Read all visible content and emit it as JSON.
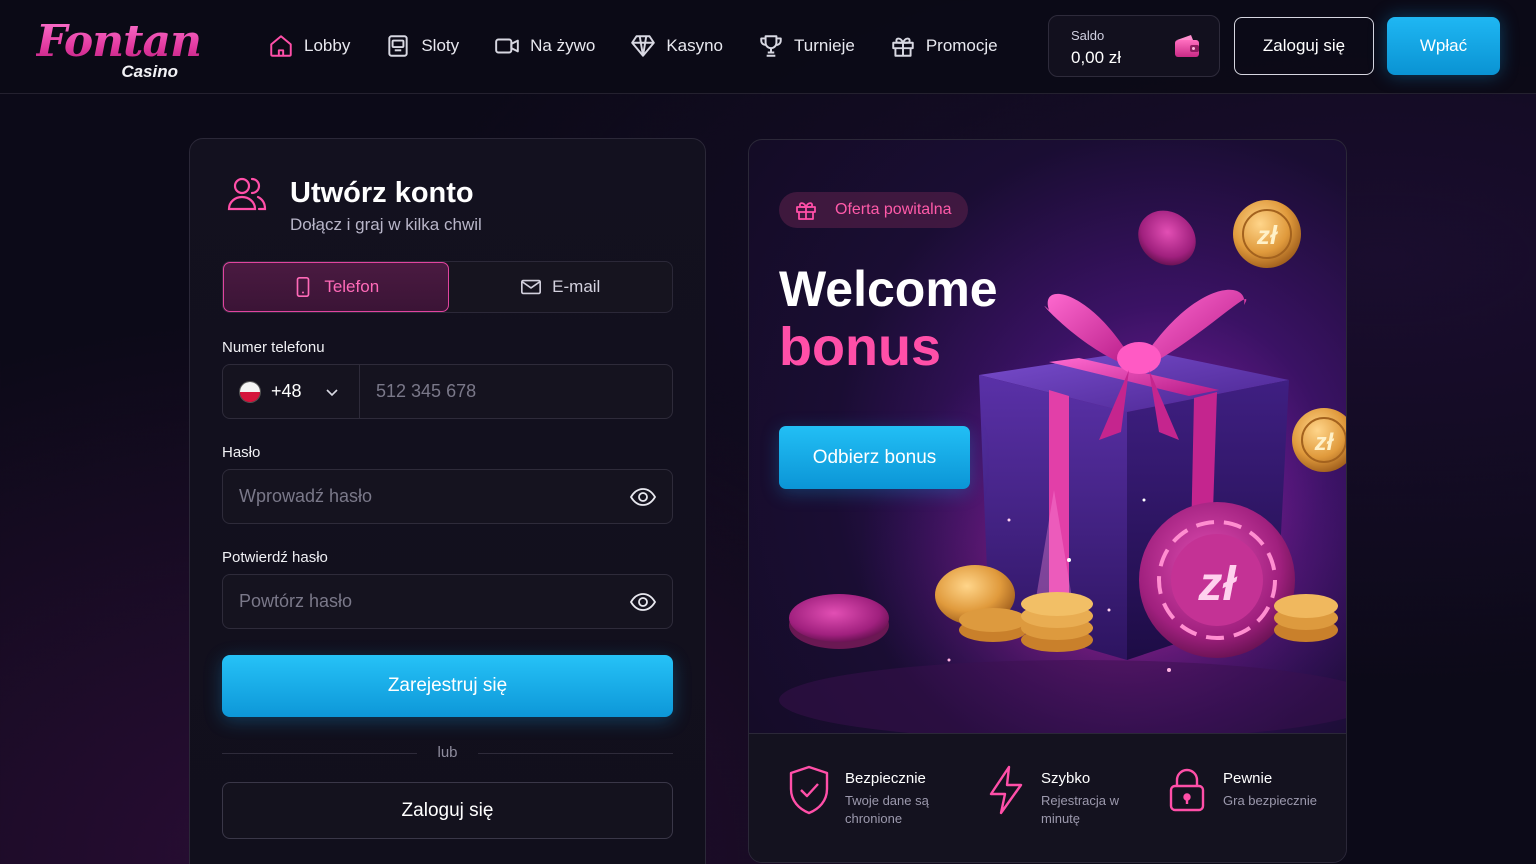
{
  "brand": {
    "name": "Fontan",
    "sub": "Casino"
  },
  "nav": [
    {
      "label": "Lobby",
      "icon": "home-icon"
    },
    {
      "label": "Sloty",
      "icon": "slot-machine-icon"
    },
    {
      "label": "Na żywo",
      "icon": "video-camera-icon"
    },
    {
      "label": "Kasyno",
      "icon": "diamond-icon"
    },
    {
      "label": "Turnieje",
      "icon": "trophy-icon"
    },
    {
      "label": "Promocje",
      "icon": "gift-icon"
    }
  ],
  "balance": {
    "label": "Saldo",
    "value": "0,00 zł"
  },
  "header_buttons": {
    "login": "Zaloguj się",
    "deposit": "Wpłać"
  },
  "register": {
    "title": "Utwórz konto",
    "subtitle": "Dołącz i graj w kilka chwil",
    "tabs": [
      {
        "label": "Telefon",
        "active": true
      },
      {
        "label": "E-mail",
        "active": false
      }
    ],
    "phone_label": "Numer telefonu",
    "country_code": "+48",
    "phone_placeholder": "512 345 678",
    "password_label": "Hasło",
    "password_placeholder": "Wprowadź hasło",
    "confirm_label": "Potwierdź hasło",
    "confirm_placeholder": "Powtórz hasło",
    "submit": "Zarejestruj się",
    "or": "lub",
    "login": "Zaloguj się"
  },
  "promo": {
    "badge": "Oferta powitalna",
    "headline1": "Welcome",
    "headline2": "bonus",
    "cta": "Odbierz bonus",
    "features": [
      {
        "title": "Bezpiecznie",
        "desc": "Twoje dane są chronione",
        "icon": "shield-check-icon"
      },
      {
        "title": "Szybko",
        "desc": "Rejestracja w minutę",
        "icon": "lightning-icon"
      },
      {
        "title": "Pewnie",
        "desc": "Gra bezpiecznie",
        "icon": "lock-icon"
      }
    ]
  },
  "colors": {
    "accent_pink": "#ff4fa8",
    "accent_blue": "#14aef0",
    "bg": "#0c0a18"
  }
}
